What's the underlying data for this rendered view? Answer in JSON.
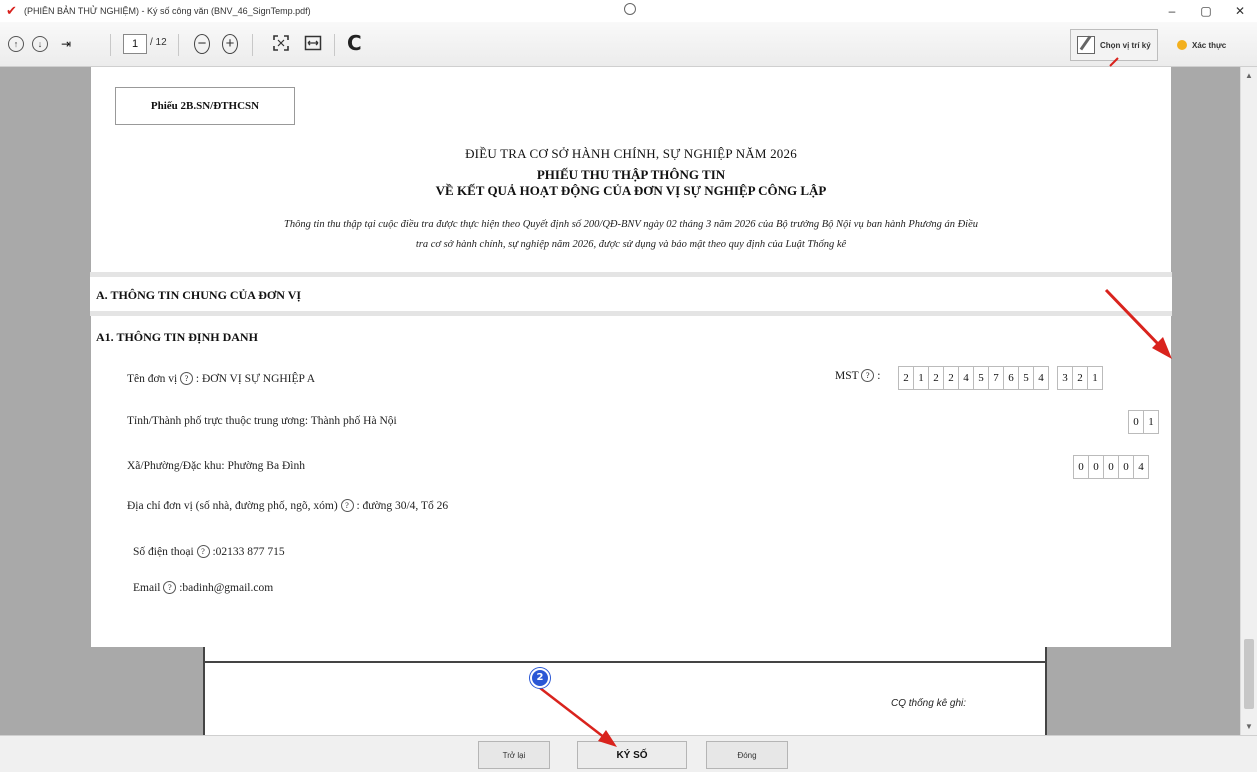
{
  "window": {
    "title": "(PHIÊN BẢN THỬ NGHIỆM) - Ký số công văn (BNV_46_SignTemp.pdf)",
    "controls": [
      "–",
      "▢",
      "✕"
    ]
  },
  "toolbar": {
    "current_page": "1",
    "total_pages": "/ 12",
    "refresh_label": "C",
    "choose_position_label": "Chọn vị trí ký",
    "verify_label": "Xác thực"
  },
  "document": {
    "form_code": "Phiếu 2B.SN/ĐTHCSN",
    "survey_title": "ĐIỀU TRA CƠ SỞ HÀNH CHÍNH, SỰ NGHIỆP NĂM 2026",
    "form_title_1": "PHIẾU THU THẬP THÔNG TIN",
    "form_title_2": "VỀ KẾT QUẢ HOẠT ĐỘNG CỦA ĐƠN VỊ SỰ NGHIỆP CÔNG LẬP",
    "intro_line_1": "Thông tin thu thập tại cuộc điều tra được thực hiện theo Quyết định số 200/QĐ-BNV ngày 02 tháng 3 năm 2026 của Bộ trưởng Bộ Nội vụ ban hành Phương án Điều",
    "intro_line_2": "tra cơ sở hành chính, sự nghiệp năm 2026, được sử dụng và bảo mật theo quy định của Luật Thống kê",
    "section_a": "A. THÔNG TIN CHUNG CỦA ĐƠN VỊ",
    "section_a1": "A1. THÔNG TIN ĐỊNH DANH",
    "unit_name_label": "Tên đơn vị",
    "unit_name_value": ": ĐƠN VỊ SỰ NGHIỆP A",
    "mst_label": "MST",
    "mst_digits": [
      "2",
      "1",
      "2",
      "2",
      "4",
      "5",
      "7",
      "6",
      "5",
      "4"
    ],
    "mst_suffix": [
      "3",
      "2",
      "1"
    ],
    "province_label": "Tỉnh/Thành phố trực thuộc trung ương: Thành phố Hà Nội",
    "province_code": [
      "0",
      "1"
    ],
    "ward_label": "Xã/Phường/Đặc khu: Phường Ba Đình",
    "ward_code": [
      "0",
      "0",
      "0",
      "0",
      "4"
    ],
    "address_label": "Địa chỉ đơn vị (số nhà, đường phố, ngõ, xóm)",
    "address_value": ": đường 30/4, Tổ 26",
    "phone_label": "Số điện thoại",
    "phone_value": ":02133 877 715",
    "email_label": "Email",
    "email_value": ":badinh@gmail.com",
    "help_glyph": "?",
    "cq_note": "CQ thống kê ghi:"
  },
  "footer": {
    "back_label": "Trở lại",
    "sign_label": "KÝ SỐ",
    "close_label": "Đóng"
  },
  "annotations": {
    "step_badge": "2"
  },
  "colors": {
    "arrow": "#d9231d",
    "badge": "#2a57d5",
    "viewer_bg": "#a9a9a9"
  }
}
